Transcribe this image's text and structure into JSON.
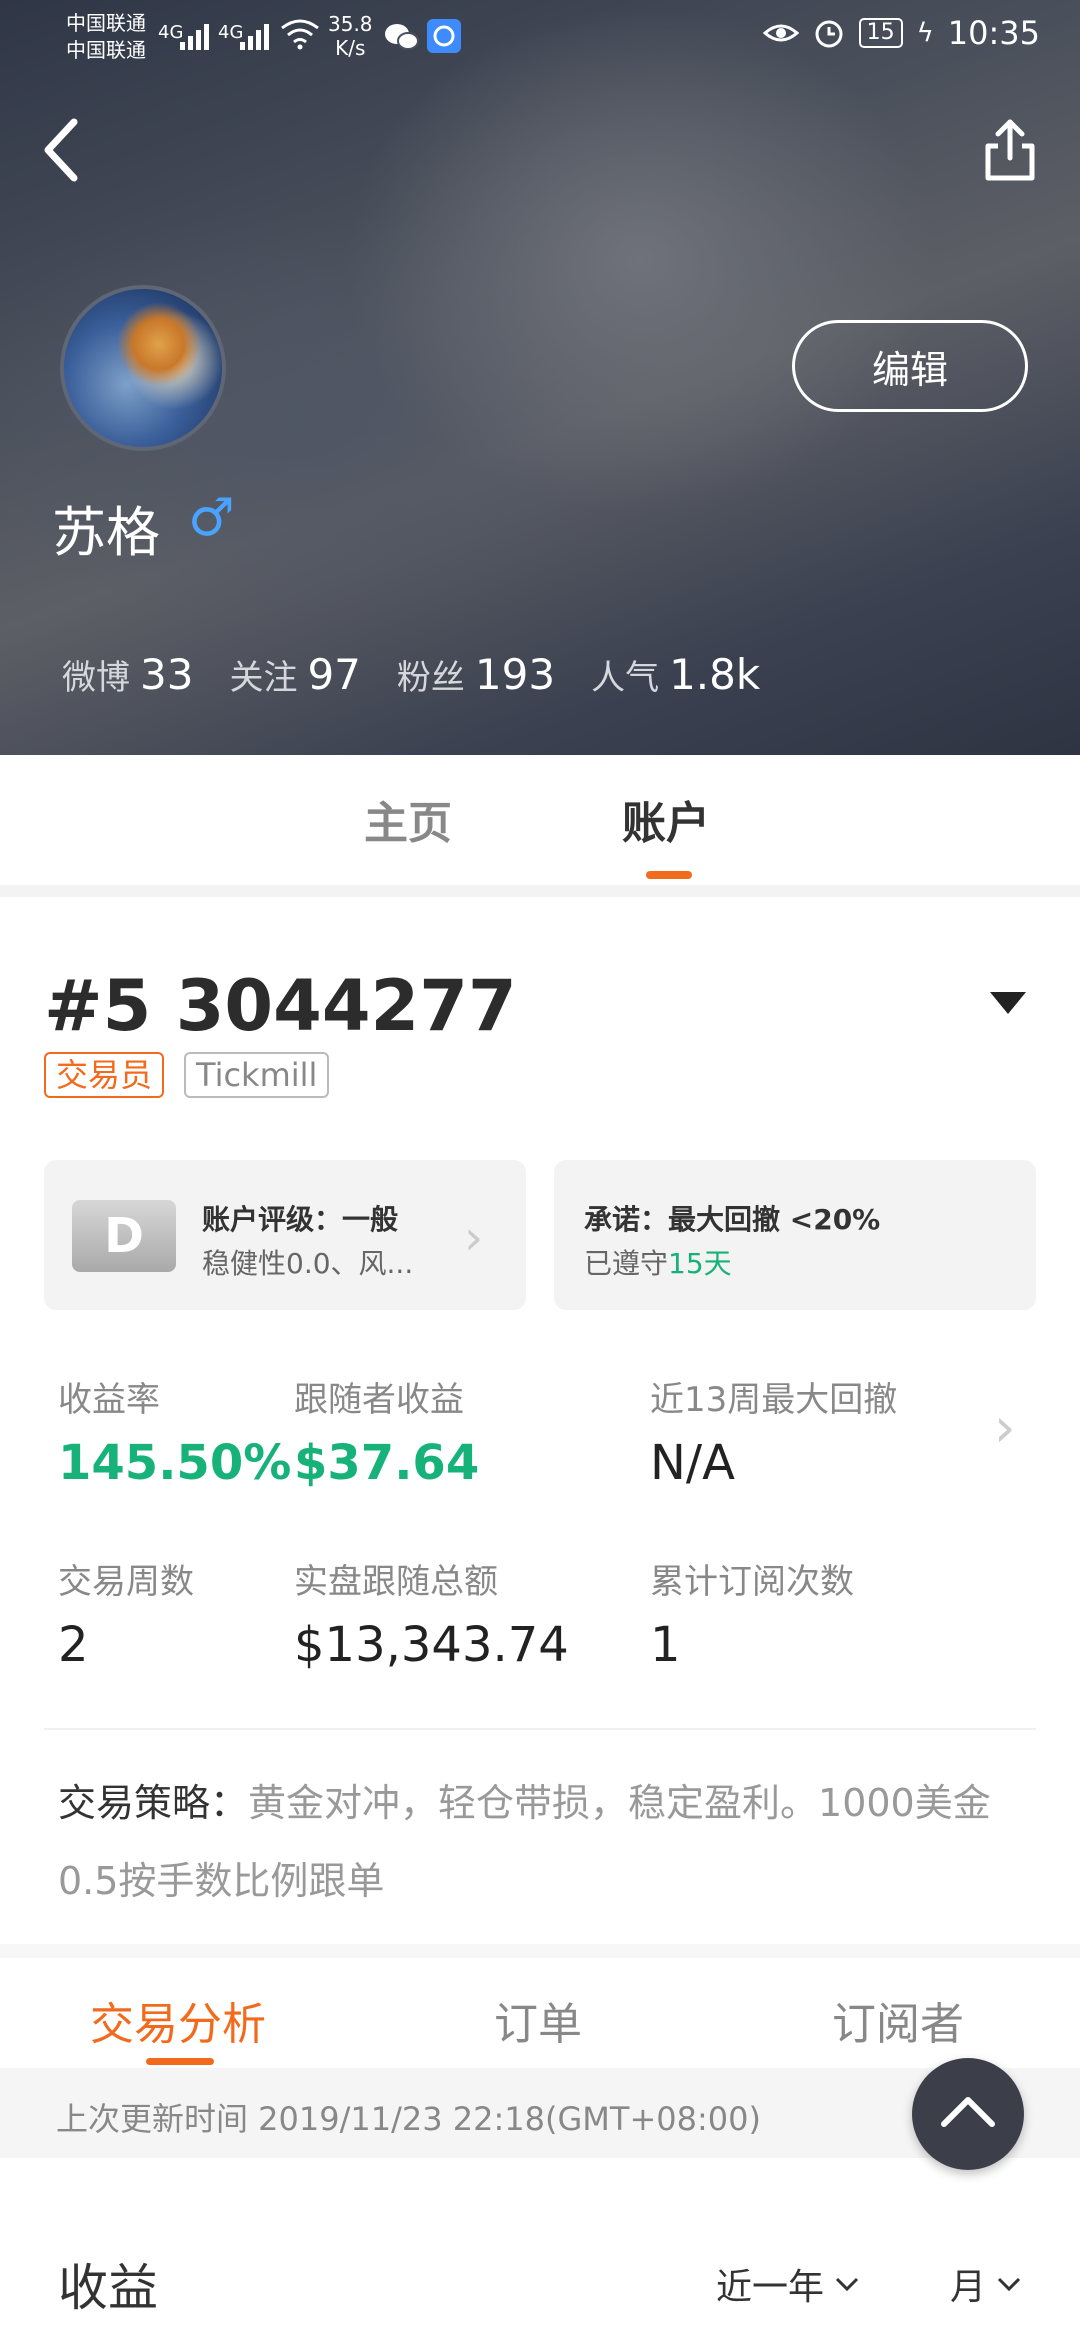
{
  "status_bar": {
    "carrier_1": "中国联通",
    "carrier_2": "中国联通",
    "signal_1": "4G",
    "signal_2": "4G",
    "net_speed": "35.8",
    "net_speed_unit": "K/s",
    "battery": "15",
    "time": "10:35"
  },
  "profile": {
    "name": "苏格",
    "gender_symbol": "♂",
    "edit_label": "编辑",
    "stats": [
      {
        "label": "微博",
        "value": "33"
      },
      {
        "label": "关注",
        "value": "97"
      },
      {
        "label": "粉丝",
        "value": "193"
      },
      {
        "label": "人气",
        "value": "1.8k"
      }
    ]
  },
  "tabs": {
    "home": "主页",
    "account": "账户"
  },
  "account": {
    "title": "#5 3044277",
    "tag_trader": "交易员",
    "tag_broker": "Tickmill",
    "rating_card": {
      "badge": "D",
      "title": "账户评级：一般",
      "subtitle": "稳健性0.0、风..."
    },
    "promise_card": {
      "title": "承诺：最大回撤 <20%",
      "subtitle_prefix": "已遵守",
      "subtitle_value": "15天"
    },
    "metrics": [
      {
        "label": "收益率",
        "value": "145.50%"
      },
      {
        "label": "跟随者收益",
        "value": "$37.64"
      },
      {
        "label": "近13周最大回撤",
        "value": "N/A"
      },
      {
        "label": "交易周数",
        "value": "2"
      },
      {
        "label": "实盘跟随总额",
        "value": "$13,343.74"
      },
      {
        "label": "累计订阅次数",
        "value": "1"
      }
    ],
    "strategy_label": "交易策略：",
    "strategy_text": "黄金对冲，轻仓带损，稳定盈利。1000美金0.5按手数比例跟单"
  },
  "sub_tabs": {
    "analysis": "交易分析",
    "orders": "订单",
    "subscribers": "订阅者"
  },
  "update_text": "上次更新时间 2019/11/23 22:18(GMT+08:00)",
  "earnings": {
    "title": "收益",
    "range_filter": "近一年",
    "period_filter": "月"
  },
  "colors": {
    "accent": "#f26b1d",
    "positive": "#17b27a",
    "gender": "#4aa3ff"
  }
}
